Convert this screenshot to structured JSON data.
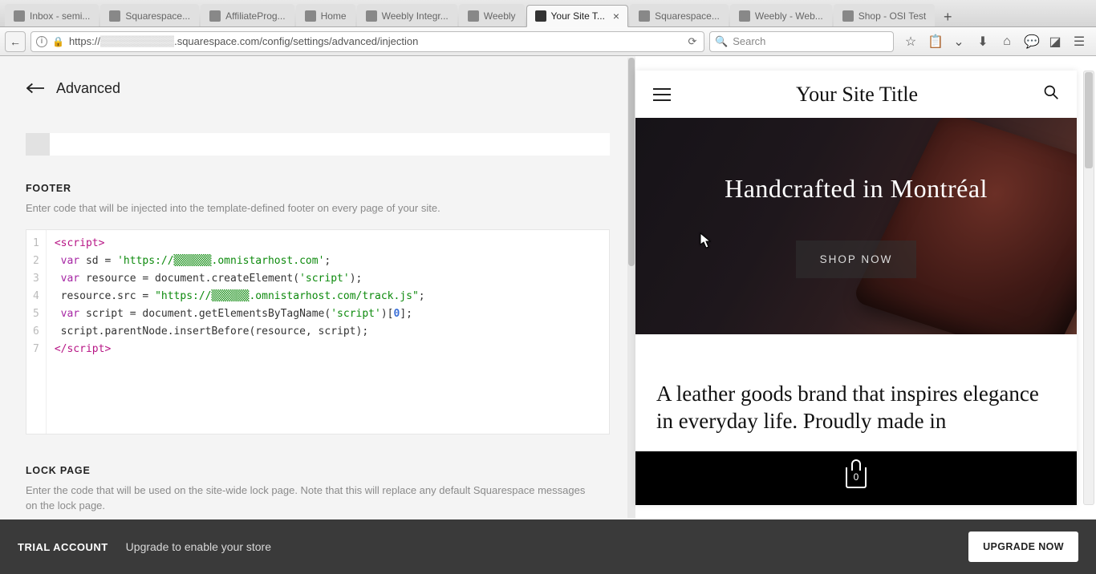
{
  "browser": {
    "tabs": [
      {
        "label": "Inbox - semi..."
      },
      {
        "label": "Squarespace..."
      },
      {
        "label": "AffiliateProg..."
      },
      {
        "label": "Home"
      },
      {
        "label": "Weebly Integr..."
      },
      {
        "label": "Weebly"
      },
      {
        "label": "Your Site T...",
        "active": true
      },
      {
        "label": "Squarespace..."
      },
      {
        "label": "Weebly - Web..."
      },
      {
        "label": "Shop - OSI Test"
      }
    ],
    "url_prefix": "https://",
    "url_blur": "▒▒▒▒▒▒▒▒▒▒",
    "url_rest": ".squarespace.com/config/settings/advanced/injection",
    "search_placeholder": "Search"
  },
  "config": {
    "back_label": "Advanced",
    "footer": {
      "title": "FOOTER",
      "desc": "Enter code that will be injected into the template-defined footer on every page of your site."
    },
    "code": {
      "l1a": "<script>",
      "l2_kw": "var",
      "l2_rest": " sd = ",
      "l2_str": "'https://▒▒▒▒▒▒.omnistarhost.com'",
      "l2_end": ";",
      "l3_kw": "var",
      "l3_rest": " resource = document.createElement(",
      "l3_str": "'script'",
      "l3_end": ");",
      "l4_a": " resource.src = ",
      "l4_str": "\"https://▒▒▒▒▒▒.omnistarhost.com/track.js\"",
      "l4_end": ";",
      "l5_kw": "var",
      "l5_a": " script = document.getElementsByTagName(",
      "l5_str": "'script'",
      "l5_b": ")[",
      "l5_num": "0",
      "l5_end": "];",
      "l6": " script.parentNode.insertBefore(resource, script);",
      "l7": "</scr"
    },
    "code_l7_suffix": "ipt>",
    "lock": {
      "title": "LOCK PAGE",
      "desc": "Enter the code that will be used on the site-wide lock page. Note that this will replace any default Squarespace messages on the lock page."
    }
  },
  "preview": {
    "site_title": "Your Site Title",
    "hero_heading": "Handcrafted in Montréal",
    "shop_btn": "SHOP NOW",
    "body_text": "A leather goods brand that inspires elegance in everyday life. Proudly made in",
    "cart_count": "0"
  },
  "bottom": {
    "trial": "TRIAL ACCOUNT",
    "desc": "Upgrade to enable your store",
    "btn": "UPGRADE NOW"
  },
  "gutter": {
    "n1": "1",
    "n2": "2",
    "n3": "3",
    "n4": "4",
    "n5": "5",
    "n6": "6",
    "n7": "7"
  }
}
